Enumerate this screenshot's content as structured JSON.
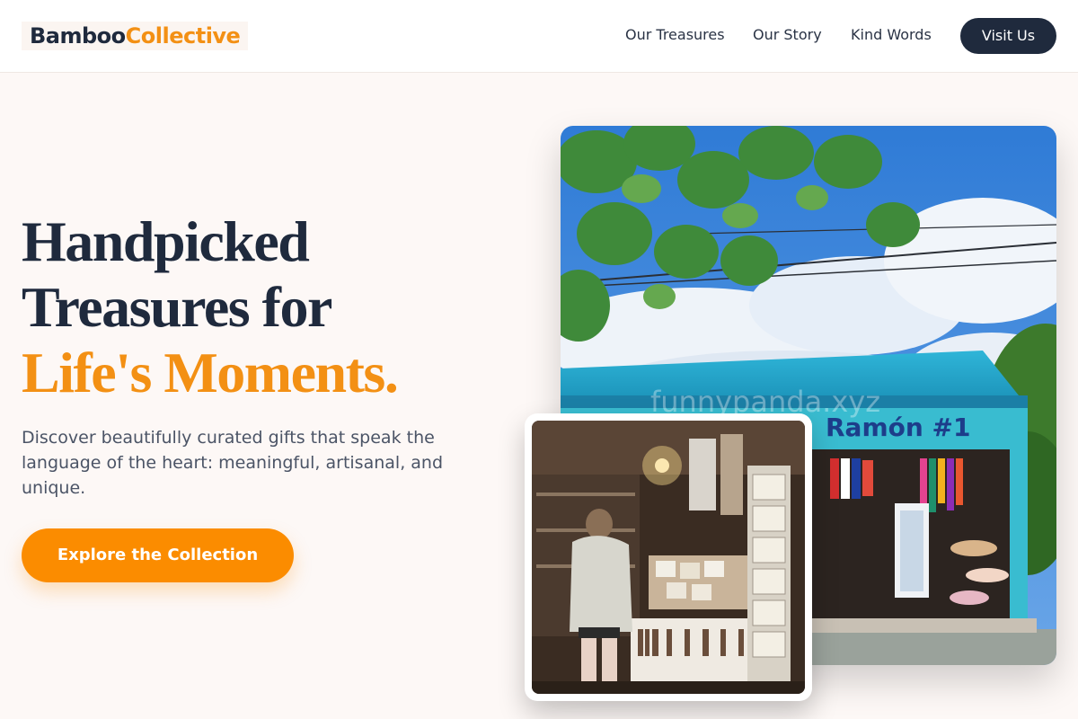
{
  "brand": {
    "name_part1": "Bamboo",
    "name_part2": "Collective"
  },
  "nav": {
    "items": [
      {
        "label": "Our Treasures"
      },
      {
        "label": "Our Story"
      },
      {
        "label": "Kind Words"
      }
    ],
    "cta_label": "Visit Us"
  },
  "hero": {
    "headline_line1": "Handpicked",
    "headline_line2": "Treasures for",
    "headline_accent": "Life's Moments.",
    "subtext": "Discover beautifully curated gifts that speak the language of the heart: meaningful, artisanal, and unique.",
    "cta_label": "Explore the Collection"
  },
  "images": {
    "shop_front_sign": "Ramón #1",
    "watermark": "funnypanda.xyz"
  },
  "colors": {
    "accent": "#f39014",
    "cta_orange": "#fb8c00",
    "navy": "#1f2a3d",
    "background": "#fdf8f6"
  }
}
